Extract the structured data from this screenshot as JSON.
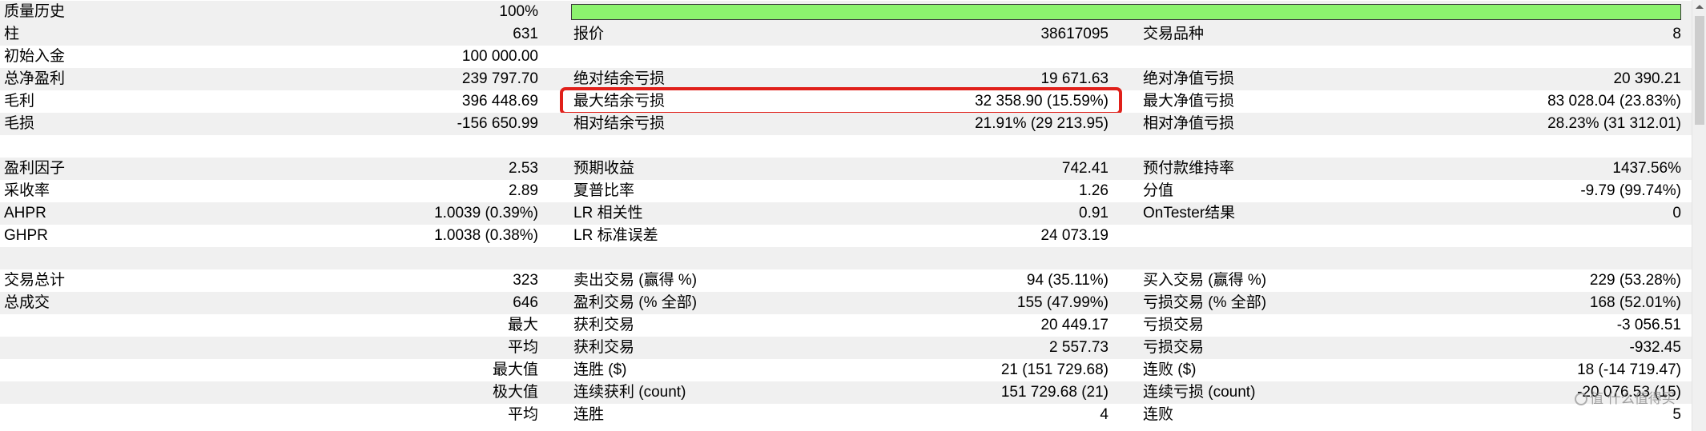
{
  "colors": {
    "row_shade": "#f0f0f0",
    "quality_bar": "#8cf36e",
    "highlight_border": "#e0201a"
  },
  "rows": [
    {
      "shaded": true,
      "c1": "质量历史",
      "c2": "100%",
      "quality_bar": 1.0
    },
    {
      "shaded": true,
      "c1": "柱",
      "c2": "631",
      "c3": "报价",
      "c4": "38617095",
      "c5": "交易品种",
      "c6": "8"
    },
    {
      "shaded": false,
      "c1": "初始入金",
      "c2": "100 000.00"
    },
    {
      "shaded": true,
      "c1": "总净盈利",
      "c2": "239 797.70",
      "c3": "绝对结余亏损",
      "c4": "19 671.63",
      "c5": "绝对净值亏损",
      "c6": "20 390.21"
    },
    {
      "shaded": false,
      "c1": "毛利",
      "c2": "396 448.69",
      "c3": "最大结余亏损",
      "c4": "32 358.90 (15.59%)",
      "c5": "最大净值亏损",
      "c6": "83 028.04 (23.83%)",
      "highlighted": true
    },
    {
      "shaded": true,
      "c1": "毛损",
      "c2": "-156 650.99",
      "c3": "相对结余亏损",
      "c4": "21.91% (29 213.95)",
      "c5": "相对净值亏损",
      "c6": "28.23% (31 312.01)"
    },
    {
      "shaded": false
    },
    {
      "shaded": true,
      "c1": "盈利因子",
      "c2": "2.53",
      "c3": "预期收益",
      "c4": "742.41",
      "c5": "预付款维持率",
      "c6": "1437.56%"
    },
    {
      "shaded": false,
      "c1": "采收率",
      "c2": "2.89",
      "c3": "夏普比率",
      "c4": "1.26",
      "c5": "分值",
      "c6": "-9.79 (99.74%)"
    },
    {
      "shaded": true,
      "c1": "AHPR",
      "c2": "1.0039 (0.39%)",
      "c3": "LR 相关性",
      "c4": "0.91",
      "c5": "OnTester结果",
      "c6": "0"
    },
    {
      "shaded": false,
      "c1": "GHPR",
      "c2": "1.0038 (0.38%)",
      "c3": "LR 标准误差",
      "c4": "24 073.19"
    },
    {
      "shaded": true
    },
    {
      "shaded": false,
      "c1": "交易总计",
      "c2": "323",
      "c3": "卖出交易 (赢得 %)",
      "c4": "94 (35.11%)",
      "c5": "买入交易 (赢得 %)",
      "c6": "229 (53.28%)"
    },
    {
      "shaded": true,
      "c1": "总成交",
      "c2": "646",
      "c3": "盈利交易 (% 全部)",
      "c4": "155 (47.99%)",
      "c5": "亏损交易 (% 全部)",
      "c6": "168 (52.01%)"
    },
    {
      "shaded": false,
      "c2": "最大",
      "c3": "获利交易",
      "c4": "20 449.17",
      "c5": "亏损交易",
      "c6": "-3 056.51"
    },
    {
      "shaded": true,
      "c2": "平均",
      "c3": "获利交易",
      "c4": "2 557.73",
      "c5": "亏损交易",
      "c6": "-932.45"
    },
    {
      "shaded": false,
      "c2": "最大值",
      "c3": "连胜 ($)",
      "c4": "21 (151 729.68)",
      "c5": "连败 ($)",
      "c6": "18 (-14 719.47)"
    },
    {
      "shaded": true,
      "c2": "极大值",
      "c3": "连续获利 (count)",
      "c4": "151 729.68 (21)",
      "c5": "连续亏损 (count)",
      "c6": "-20 076.53 (15)"
    },
    {
      "shaded": false,
      "c2": "平均",
      "c3": "连胜",
      "c4": "4",
      "c5": "连败",
      "c6": "5"
    }
  ],
  "watermark": {
    "text": "值 什么值得买"
  }
}
